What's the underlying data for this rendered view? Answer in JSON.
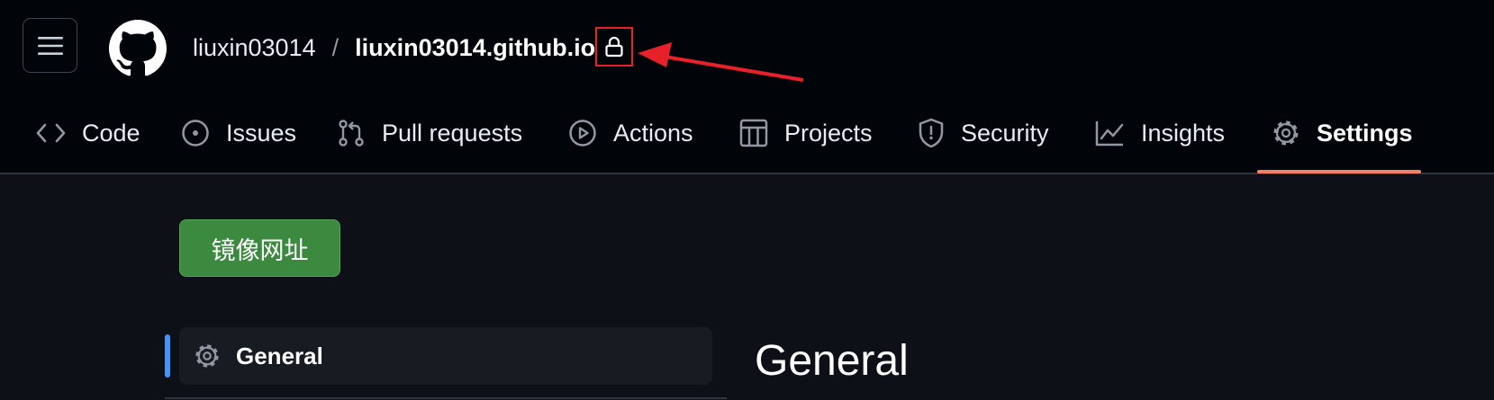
{
  "header": {
    "owner": "liuxin03014",
    "separator": "/",
    "repo": "liuxin03014.github.io",
    "visibility_icon": "lock-icon",
    "annotation_color": "#e8202a"
  },
  "tabs": [
    {
      "label": "Code",
      "icon": "code-icon"
    },
    {
      "label": "Issues",
      "icon": "issue-icon"
    },
    {
      "label": "Pull requests",
      "icon": "pull-request-icon"
    },
    {
      "label": "Actions",
      "icon": "play-icon"
    },
    {
      "label": "Projects",
      "icon": "table-icon"
    },
    {
      "label": "Security",
      "icon": "shield-icon"
    },
    {
      "label": "Insights",
      "icon": "graph-icon"
    },
    {
      "label": "Settings",
      "icon": "gear-icon",
      "active": true
    }
  ],
  "mirror_button": {
    "label": "镜像网址",
    "color": "#3c8a3f"
  },
  "sidebar": {
    "items": [
      {
        "label": "General",
        "icon": "gear-icon",
        "active": true
      }
    ]
  },
  "main": {
    "title": "General"
  },
  "colors": {
    "accent_underline": "#f78166",
    "sidebar_marker": "#4493f8",
    "header_bg": "#010409",
    "page_bg": "#0d1117"
  }
}
